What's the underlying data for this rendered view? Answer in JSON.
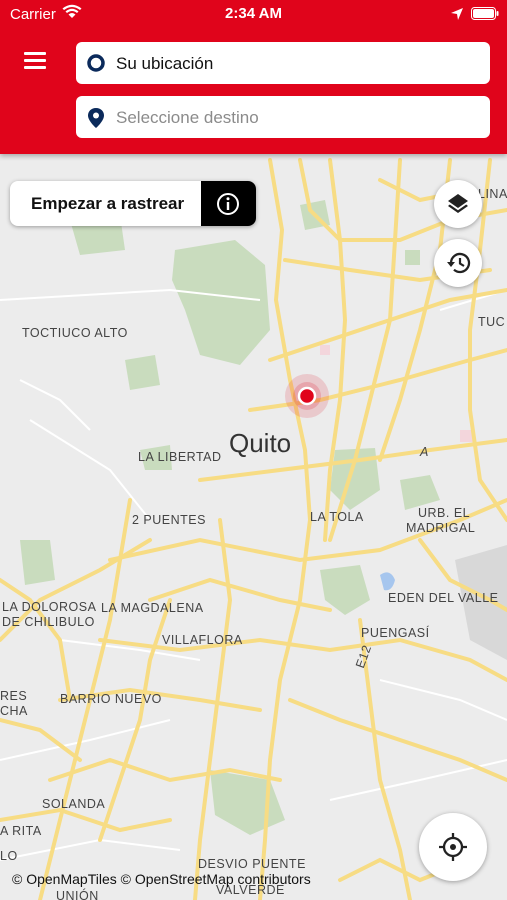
{
  "status_bar": {
    "carrier": "Carrier",
    "time": "2:34 AM"
  },
  "search": {
    "origin_value": "Su ubicación",
    "destination_placeholder": "Seleccione destino"
  },
  "tracking": {
    "start_label": "Empezar a rastrear"
  },
  "map": {
    "city_label": "Quito",
    "place_labels": {
      "toctiuco_alto": "TOCTIUCO ALTO",
      "la_libertad": "LA LIBERTAD",
      "dos_puentes": "2 PUENTES",
      "la_tola": "LA TOLA",
      "urb_el": "URB. EL",
      "madrigal": "MADRIGAL",
      "la_dolorosa": "LA DOLOROSA",
      "de_chilibulo": "DE CHILIBULO",
      "la_magdalena": "LA MAGDALENA",
      "eden_del_valle": "EDEN DEL VALLE",
      "villaflora": "VILLAFLORA",
      "puengasi": "PUENGASÍ",
      "res": "RES",
      "cha": "CHA",
      "barrio_nuevo": "BARRIO NUEVO",
      "solanda": "SOLANDA",
      "a_rita": "A RITA",
      "lo": "LO",
      "desvio_puente": "DESVIO PUENTE",
      "valverde": "VALVERDE",
      "union": "UNIÓN",
      "tuc": "TUC",
      "lina": "LINA",
      "a": "A",
      "route_e12": "E12"
    },
    "attribution": "© OpenMapTiles © OpenStreetMap contributors"
  },
  "colors": {
    "header": "#e0041b",
    "accent_blue": "#0b2a5b",
    "marker_red": "#e0041b",
    "road_yellow": "#f7dc84"
  },
  "icons": {
    "menu": "hamburger-icon",
    "origin": "ring-icon",
    "destination": "map-pin-icon",
    "info": "info-icon",
    "layers": "layers-icon",
    "history": "history-icon",
    "locate": "crosshair-icon"
  }
}
